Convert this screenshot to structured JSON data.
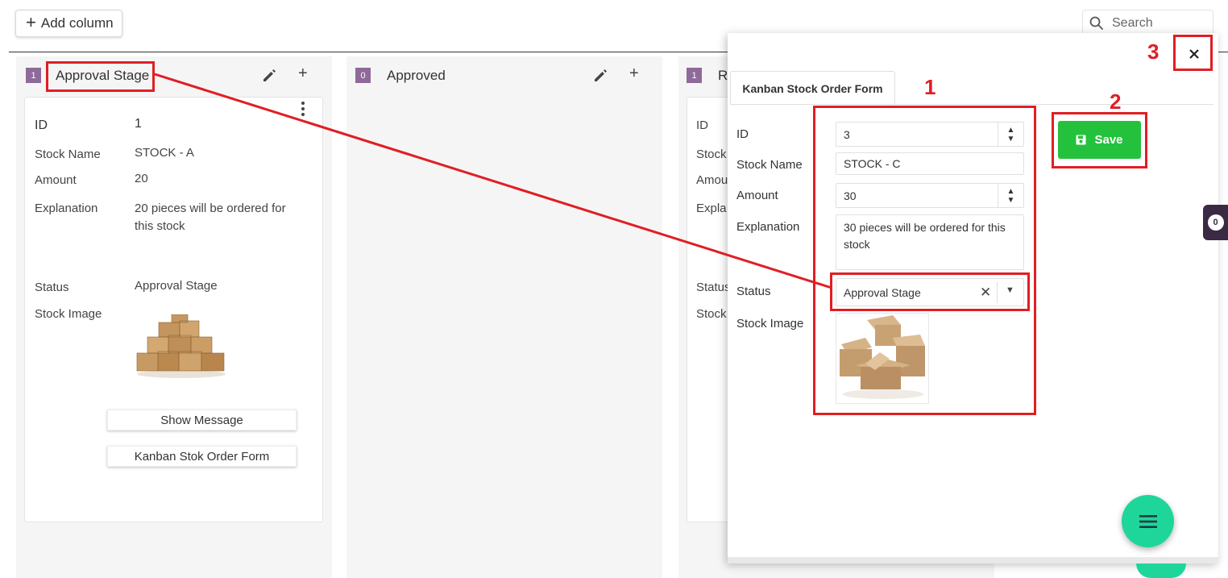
{
  "toolbar": {
    "add_column_label": "Add column",
    "search_placeholder": "Search"
  },
  "columns": [
    {
      "count": "1",
      "title": "Approval Stage",
      "card": {
        "fields": [
          {
            "label": "ID",
            "value": "1"
          },
          {
            "label": "Stock Name",
            "value": "STOCK - A"
          },
          {
            "label": "Amount",
            "value": "20"
          },
          {
            "label": "Explanation",
            "value": "20 pieces will be ordered for this stock"
          },
          {
            "label": "Status",
            "value": "Approval Stage"
          },
          {
            "label": "Stock Image",
            "value": ""
          }
        ],
        "buttons": [
          "Show Message",
          "Kanban Stok Order Form"
        ]
      }
    },
    {
      "count": "0",
      "title": "Approved"
    },
    {
      "count": "1",
      "title": "R",
      "card_labels": [
        "ID",
        "Stock",
        "Amou",
        "Expla",
        "Status",
        "Stock"
      ]
    }
  ],
  "modal": {
    "tab_label": "Kanban Stock Order Form",
    "save_label": "Save",
    "fields": {
      "id": {
        "label": "ID",
        "value": "3"
      },
      "stock_name": {
        "label": "Stock Name",
        "value": "STOCK - C"
      },
      "amount": {
        "label": "Amount",
        "value": "30"
      },
      "explanation": {
        "label": "Explanation",
        "value": "30 pieces will be ordered for this stock"
      },
      "status": {
        "label": "Status",
        "value": "Approval Stage"
      },
      "stock_image": {
        "label": "Stock Image"
      }
    }
  },
  "annotations": {
    "marker_1": "1",
    "marker_2": "2",
    "marker_3": "3"
  },
  "chat_badge": "0",
  "colors": {
    "accent_purple": "#8e6a9a",
    "save_green": "#24c23c",
    "fab_green": "#1ed69a",
    "annotation_red": "#e01e24"
  },
  "icons": [
    "plus-icon",
    "search-icon",
    "pencil-icon",
    "kebab-icon",
    "save-disk-icon",
    "close-icon",
    "clear-icon",
    "dropdown-caret-icon",
    "menu-icon",
    "chat-icon"
  ]
}
